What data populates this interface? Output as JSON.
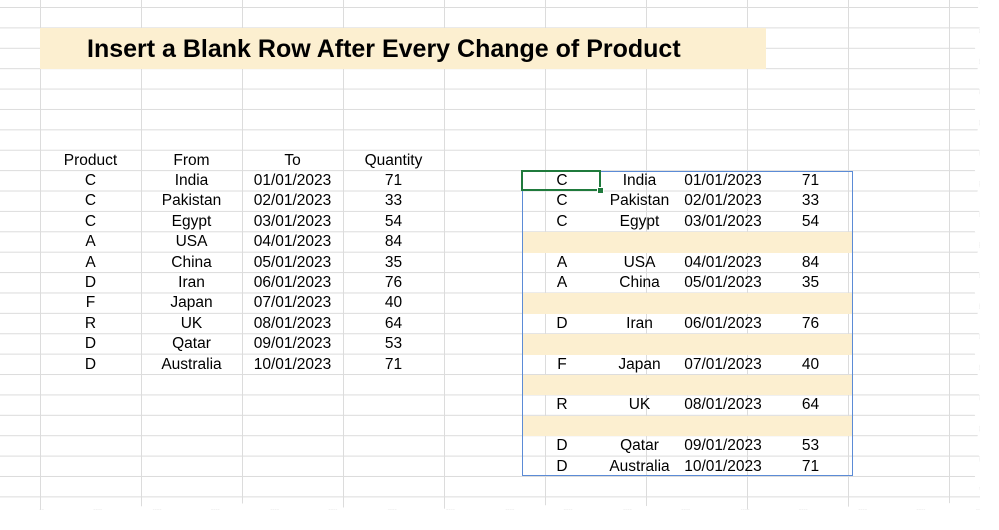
{
  "title": "Insert a Blank Row After Every Change of Product",
  "headers": [
    "Product",
    "From",
    "To",
    "Quantity"
  ],
  "left_rows": [
    [
      "C",
      "India",
      "01/01/2023",
      "71"
    ],
    [
      "C",
      "Pakistan",
      "02/01/2023",
      "33"
    ],
    [
      "C",
      "Egypt",
      "03/01/2023",
      "54"
    ],
    [
      "A",
      "USA",
      "04/01/2023",
      "84"
    ],
    [
      "A",
      "China",
      "05/01/2023",
      "35"
    ],
    [
      "D",
      "Iran",
      "06/01/2023",
      "76"
    ],
    [
      "F",
      "Japan",
      "07/01/2023",
      "40"
    ],
    [
      "R",
      "UK",
      "08/01/2023",
      "64"
    ],
    [
      "D",
      "Qatar",
      "09/01/2023",
      "53"
    ],
    [
      "D",
      "Australia",
      "10/01/2023",
      "71"
    ]
  ],
  "right_rows": [
    [
      "C",
      "India",
      "01/01/2023",
      "71"
    ],
    [
      "C",
      "Pakistan",
      "02/01/2023",
      "33"
    ],
    [
      "C",
      "Egypt",
      "03/01/2023",
      "54"
    ],
    null,
    [
      "A",
      "USA",
      "04/01/2023",
      "84"
    ],
    [
      "A",
      "China",
      "05/01/2023",
      "35"
    ],
    null,
    [
      "D",
      "Iran",
      "06/01/2023",
      "76"
    ],
    null,
    [
      "F",
      "Japan",
      "07/01/2023",
      "40"
    ],
    null,
    [
      "R",
      "UK",
      "08/01/2023",
      "64"
    ],
    null,
    [
      "D",
      "Qatar",
      "09/01/2023",
      "53"
    ],
    [
      "D",
      "Australia",
      "10/01/2023",
      "71"
    ]
  ],
  "colors": {
    "highlight": "#fcefd0",
    "selection_border": "#5b8bd6",
    "active_cell_border": "#1f7a3c"
  }
}
